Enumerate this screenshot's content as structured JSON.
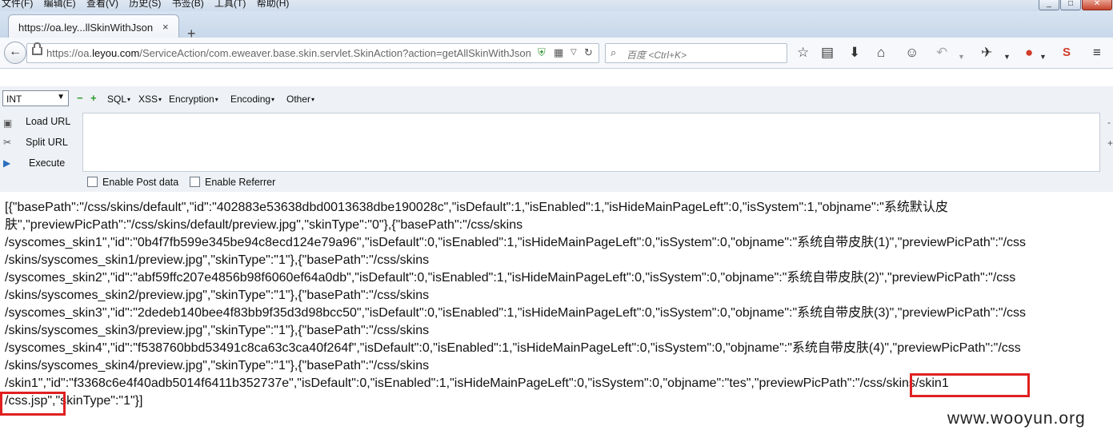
{
  "menubar": {
    "items": [
      "文件(F)",
      "编辑(E)",
      "查看(V)",
      "历史(S)",
      "书签(B)",
      "工具(T)",
      "帮助(H)"
    ],
    "window_controls": [
      "_",
      "□",
      "✕"
    ]
  },
  "tab": {
    "title": "https://oa.ley...llSkinWithJson",
    "close": "×",
    "new_tab": "+"
  },
  "navbar": {
    "back": "←",
    "url_prefix": "https://oa.",
    "url_domain": "leyou.com",
    "url_rest": "/ServiceAction/com.eweaver.base.skin.servlet.SkinAction?action=getAllSkinWithJson",
    "search_placeholder": "百度 <Ctrl+K>"
  },
  "hackbar": {
    "select_value": "INT",
    "minus": "−",
    "plus": "+",
    "menus": [
      "SQL",
      "XSS",
      "Encryption",
      "Encoding",
      "Other"
    ],
    "load_url": "Load URL",
    "split_url": "Split URL",
    "execute": "Execute",
    "enable_post": "Enable Post data",
    "enable_referrer": "Enable Referrer"
  },
  "response": {
    "lines": [
      "[{\"basePath\":\"/css/skins/default\",\"id\":\"402883e53638dbd0013638dbe190028c\",\"isDefault\":1,\"isEnabled\":1,\"isHideMainPageLeft\":0,\"isSystem\":1,\"objname\":\"系统默认皮",
      "肤\",\"previewPicPath\":\"/css/skins/default/preview.jpg\",\"skinType\":\"0\"},{\"basePath\":\"/css/skins",
      "/syscomes_skin1\",\"id\":\"0b4f7fb599e345be94c8ecd124e79a96\",\"isDefault\":0,\"isEnabled\":1,\"isHideMainPageLeft\":0,\"isSystem\":0,\"objname\":\"系统自带皮肤(1)\",\"previewPicPath\":\"/css",
      "/skins/syscomes_skin1/preview.jpg\",\"skinType\":\"1\"},{\"basePath\":\"/css/skins",
      "/syscomes_skin2\",\"id\":\"abf59ffc207e4856b98f6060ef64a0db\",\"isDefault\":0,\"isEnabled\":1,\"isHideMainPageLeft\":0,\"isSystem\":0,\"objname\":\"系统自带皮肤(2)\",\"previewPicPath\":\"/css",
      "/skins/syscomes_skin2/preview.jpg\",\"skinType\":\"1\"},{\"basePath\":\"/css/skins",
      "/syscomes_skin3\",\"id\":\"2dedeb140bee4f83bb9f35d3d98bcc50\",\"isDefault\":0,\"isEnabled\":1,\"isHideMainPageLeft\":0,\"isSystem\":0,\"objname\":\"系统自带皮肤(3)\",\"previewPicPath\":\"/css",
      "/skins/syscomes_skin3/preview.jpg\",\"skinType\":\"1\"},{\"basePath\":\"/css/skins",
      "/syscomes_skin4\",\"id\":\"f538760bbd53491c8ca63c3ca40f264f\",\"isDefault\":0,\"isEnabled\":1,\"isHideMainPageLeft\":0,\"isSystem\":0,\"objname\":\"系统自带皮肤(4)\",\"previewPicPath\":\"/css",
      "/skins/syscomes_skin4/preview.jpg\",\"skinType\":\"1\"},{\"basePath\":\"/css/skins",
      "/skin1\",\"id\":\"f3368c6e4f40adb5014f6411b352737e\",\"isDefault\":0,\"isEnabled\":1,\"isHideMainPageLeft\":0,\"isSystem\":0,\"objname\":\"tes\",\"previewPicPath\":\"/css/skins/skin1",
      "/css.jsp\",\"skinType\":\"1\"}]"
    ]
  },
  "watermark": "www.wooyun.org",
  "colors": {
    "highlight": "#e02020",
    "hackbar_bg": "#eef1f5"
  }
}
